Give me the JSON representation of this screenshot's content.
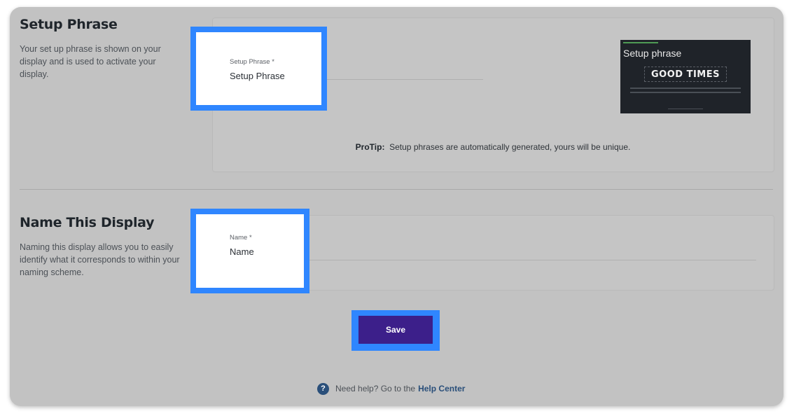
{
  "setup": {
    "title": "Setup Phrase",
    "description": "Your set up phrase is shown on your display and is used to activate your display.",
    "field_label": "Setup Phrase *",
    "field_value": "Setup Phrase",
    "preview_title": "Setup phrase",
    "preview_phrase": "GOOD TIMES",
    "protip_label": "ProTip:",
    "protip_text": "Setup phrases are automatically generated, yours will be unique."
  },
  "name_section": {
    "title": "Name This Display",
    "description": "Naming this display allows you to easily identify what it corresponds to within your naming scheme.",
    "field_label": "Name *",
    "field_value": "Name"
  },
  "save_label": "Save",
  "help": {
    "icon": "question-circle-icon",
    "text": "Need help? Go to the",
    "link": "Help Center"
  },
  "colors": {
    "highlight": "#2f86ff",
    "save_button": "#3c1f8a",
    "help_link": "#2a4f7a"
  }
}
